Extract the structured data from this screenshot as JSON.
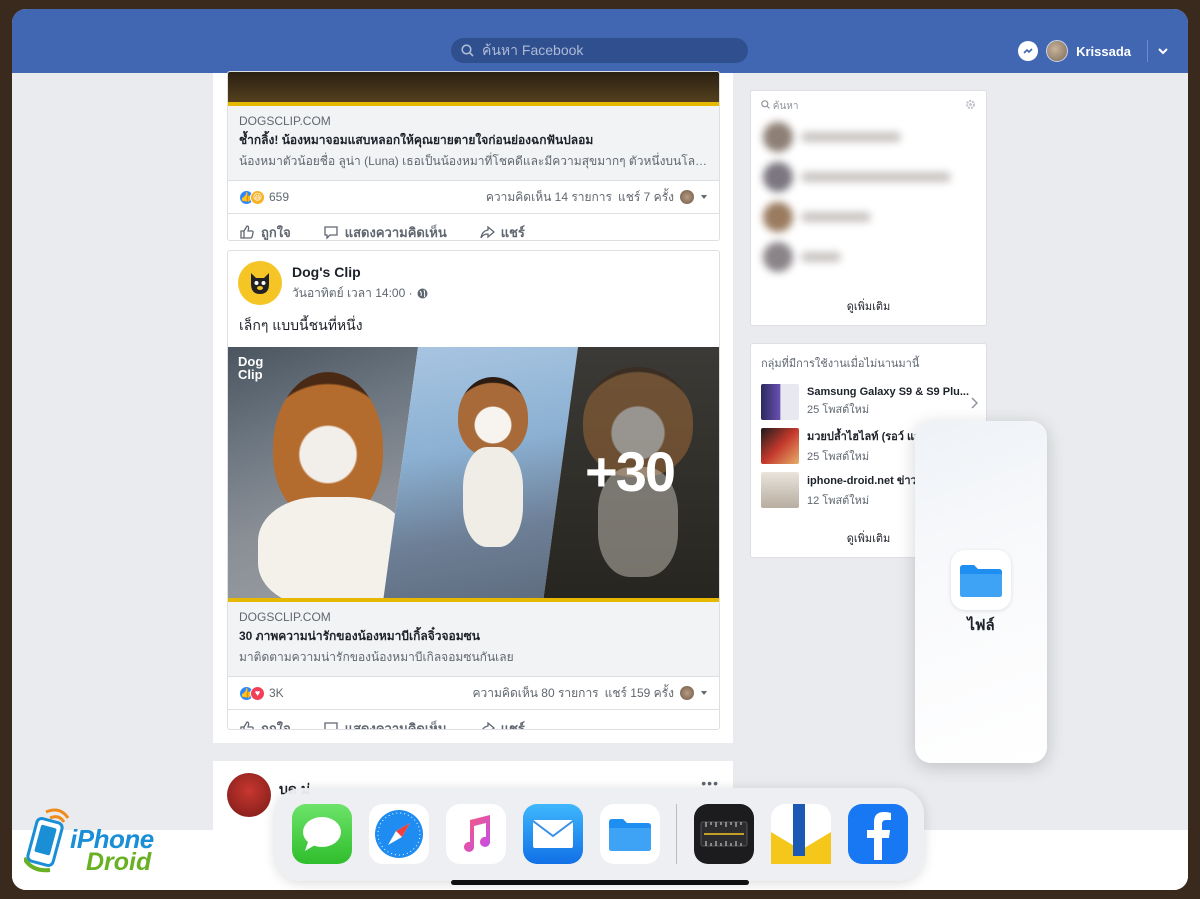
{
  "topbar": {
    "search_placeholder": "ค้นหา Facebook",
    "user_name": "Krissada"
  },
  "post1": {
    "link_domain": "DOGSCLIP.COM",
    "link_title": "ช้ำกลิ้ง! น้องหมาจอมแสบหลอกให้คุณยายตายใจก่อนย่องฉกฟันปลอม",
    "link_desc": "น้องหมาตัวน้อยชื่อ ลูน่า (Luna) เธอเป็นน้องหมาที่โชคดีและมีความสุขมากๆ ตัวหนึ่งบนโลกเลย...",
    "reaction_count": "659",
    "comments": "ความคิดเห็น 14 รายการ",
    "shares": "แชร์ 7 ครั้ง"
  },
  "post2": {
    "page_name": "Dog's Clip",
    "time": "วันอาทิตย์ เวลา 14:00 ·",
    "text": "เล็กๆ แบบนี้ชนที่หนึ่ง",
    "photo_badge_line1": "Dog",
    "photo_badge_line2": "Clip",
    "photo_overlay": "+30",
    "link_domain": "DOGSCLIP.COM",
    "link_title": "30 ภาพความน่ารักของน้องหมาบีเกิ้ลจิ๋วจอมซน",
    "link_desc": "มาติดตามความน่ารักของน้องหมาบีเกิลจอมซนกันเลย",
    "reaction_count": "3K",
    "comments": "ความคิดเห็น 80 รายการ",
    "shares": "แชร์ 159 ครั้ง"
  },
  "post3": {
    "name": "บด ม่"
  },
  "actions": {
    "like": "ถูกใจ",
    "comment": "แสดงความคิดเห็น",
    "share": "แชร์"
  },
  "sidebar": {
    "contacts_search": "ค้นหา",
    "see_more": "ดูเพิ่มเติม",
    "groups_title": "กลุ่มที่มีการใช้งานเมื่อไม่นานมานี้",
    "groups": [
      {
        "name": "Samsung Galaxy S9 & S9 Plu...",
        "sub": "25 โพสต์ใหม่"
      },
      {
        "name": "มวยปล้ำไฮไลท์ (รอว์ แสม",
        "sub": "25 โพสต์ใหม่"
      },
      {
        "name": "iphone-droid.net ข่าวส",
        "sub": "12 โพสต์ใหม่"
      }
    ],
    "groups_see_more": "ดูเพิ่มเติม"
  },
  "slideover": {
    "app_label": "ไฟล์"
  },
  "dock": {
    "apps": [
      "messages-icon",
      "safari-icon",
      "music-icon",
      "mail-icon",
      "files-icon",
      "measure-icon",
      "keynote-icon",
      "facebook-icon"
    ]
  },
  "watermark": {
    "line1": "iPhone",
    "line2": "Droid"
  },
  "colors": {
    "facebook_blue": "#4267b2",
    "like_blue": "#2d88ff",
    "files_blue": "#1f8ef1"
  }
}
